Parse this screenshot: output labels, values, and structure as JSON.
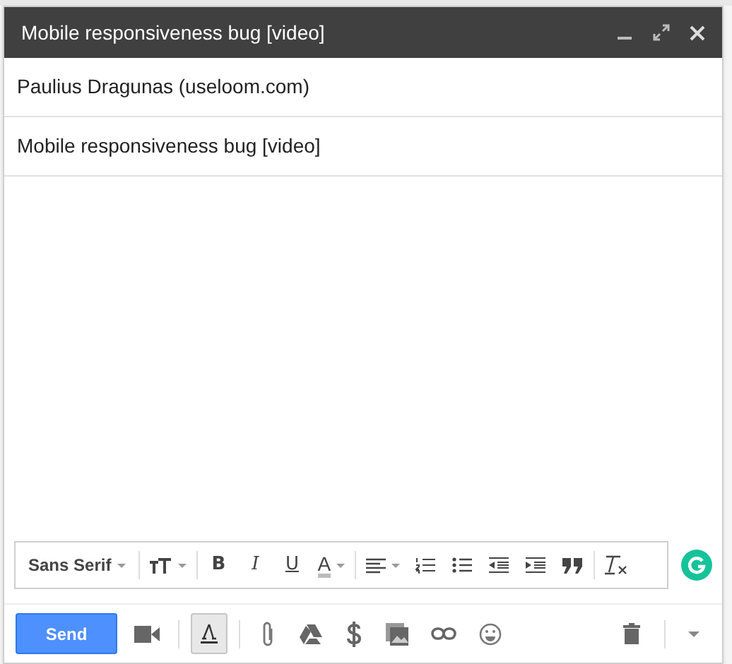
{
  "window": {
    "title": "Mobile responsiveness bug [video]"
  },
  "recipients": "Paulius Dragunas (useloom.com)",
  "subject": "Mobile responsiveness bug [video]",
  "format_toolbar": [
    {
      "kind": "font",
      "label": "Sans Serif"
    },
    {
      "kind": "size"
    },
    {
      "kind": "bold",
      "label": "B"
    },
    {
      "kind": "italic",
      "label": "I"
    },
    {
      "kind": "underline",
      "label": "U"
    },
    {
      "kind": "color",
      "label": "A"
    },
    {
      "kind": "align"
    },
    {
      "kind": "numbered"
    },
    {
      "kind": "bulleted"
    },
    {
      "kind": "outdent"
    },
    {
      "kind": "indent"
    },
    {
      "kind": "quote"
    },
    {
      "kind": "clear"
    }
  ],
  "bottom_bar": {
    "send": "Send",
    "formatting_selected": true
  }
}
